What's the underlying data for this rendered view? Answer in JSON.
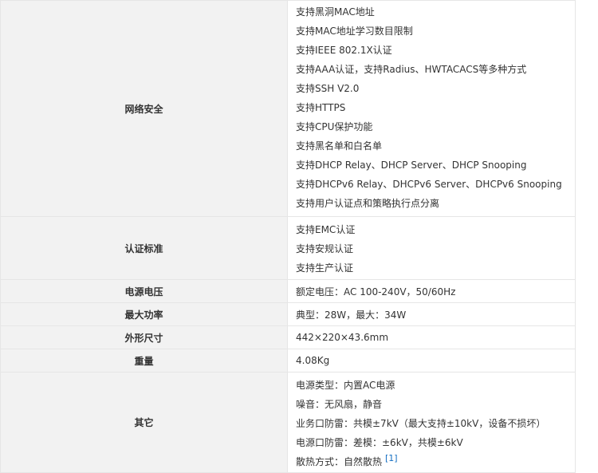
{
  "rows": [
    {
      "label": "网络安全",
      "values": [
        "支持黑洞MAC地址",
        "支持MAC地址学习数目限制",
        "支持IEEE 802.1X认证",
        "支持AAA认证，支持Radius、HWTACACS等多种方式",
        "支持SSH V2.0",
        "支持HTTPS",
        "支持CPU保护功能",
        "支持黑名单和白名单",
        "支持DHCP Relay、DHCP Server、DHCP Snooping",
        "支持DHCPv6 Relay、DHCPv6 Server、DHCPv6 Snooping",
        "支持用户认证点和策略执行点分离"
      ]
    },
    {
      "label": "认证标准",
      "values": [
        "支持EMC认证",
        "支持安规认证",
        "支持生产认证"
      ]
    },
    {
      "label": "电源电压",
      "values": [
        "额定电压：AC 100-240V，50/60Hz"
      ]
    },
    {
      "label": "最大功率",
      "values": [
        "典型：28W，最大：34W"
      ]
    },
    {
      "label": "外形尺寸",
      "values": [
        "442×220×43.6mm"
      ]
    },
    {
      "label": "重量",
      "values": [
        "4.08Kg"
      ]
    },
    {
      "label": "其它",
      "values": [
        "电源类型：内置AC电源",
        "噪音：无风扇，静音",
        "业务口防雷：共模±7kV（最大支持±10kV，设备不损坏）",
        "电源口防雷：差模：±6kV，共模±6kV",
        "散热方式：自然散热"
      ],
      "footnote": "[1]"
    }
  ]
}
